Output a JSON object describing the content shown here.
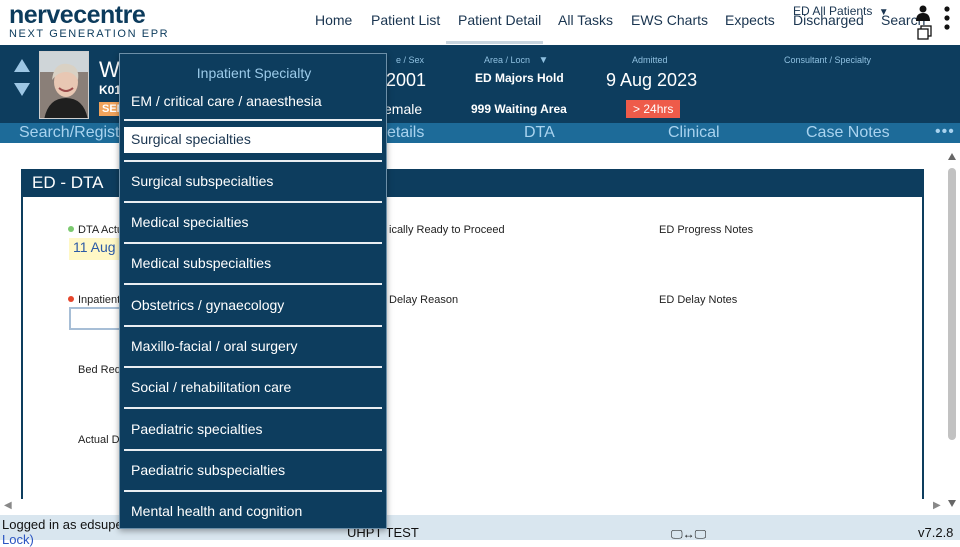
{
  "app": {
    "logo_main": "nervecentre",
    "logo_sub": "NEXT GENERATION EPR"
  },
  "nav": {
    "items": [
      "Home",
      "Patient List",
      "Patient Detail",
      "All Tasks",
      "EWS Charts",
      "Expects",
      "Discharged",
      "Search"
    ],
    "active": "Patient Detail",
    "ward_select": "ED All Patients"
  },
  "patient": {
    "name_initial": "W",
    "id_partial": "K01",
    "badge": "SEN",
    "dob_label": "e / Sex",
    "dob_value": "2001",
    "sex_value": "emale",
    "area_label": "Area / Locn",
    "area_value": "ED Majors Hold",
    "location_value": "999 Waiting Area",
    "admitted_label": "Admitted",
    "admitted_value": "9 Aug 2023",
    "los_badge": "> 24hrs",
    "consultant_label": "Consultant / Specialty"
  },
  "tabs": {
    "items": [
      "Search/Regist",
      "etails",
      "DTA",
      "Clinical",
      "Case Notes"
    ],
    "more": "•••"
  },
  "panel": {
    "title": "ED - DTA",
    "fields": {
      "dta_actual_label": "DTA Actu",
      "dta_actual_value": "11 Aug",
      "ready_label": "ically Ready to Proceed",
      "progress_notes_label": "ED Progress Notes",
      "inpatient_label": "Inpatient",
      "delay_reason_label": "Delay Reason",
      "delay_notes_label": "ED Delay Notes",
      "bed_req_label": "Bed Req",
      "actual_label": "Actual D"
    }
  },
  "dropdown": {
    "title": "Inpatient Specialty",
    "items": [
      "EM / critical care / anaesthesia",
      "Surgical specialties",
      "Surgical subspecialties",
      "Medical specialties",
      "Medical subspecialties",
      "Obstetrics / gynaecology",
      "Maxillo-facial / oral surgery",
      "Social / rehabilitation care",
      "Paediatric specialties",
      "Paediatric subspecialties",
      "Mental health and cognition"
    ],
    "selected": "Surgical specialties"
  },
  "status": {
    "logged_in": "Logged in as edsupe",
    "lock_link": "Lock)",
    "center": "UHPT TEST",
    "icons": "🖵↔🖵",
    "version": "v7.2.8"
  },
  "colors": {
    "banner": "#0d3d5e",
    "tabstrip": "#1d6b99",
    "alert": "#ee5b4a",
    "badge": "#f0a35c",
    "status": "#d9e6ef"
  }
}
